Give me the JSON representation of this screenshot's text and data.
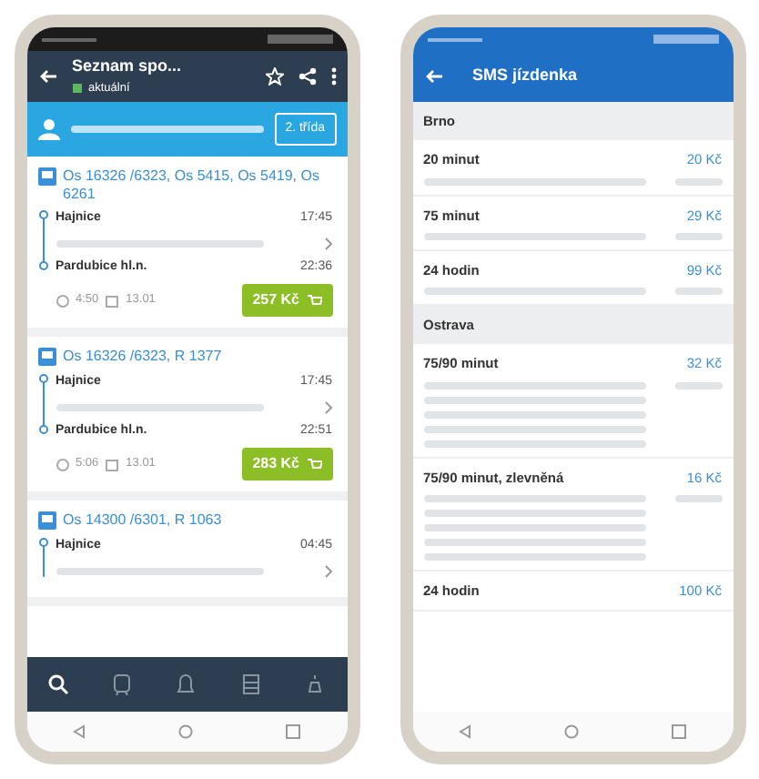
{
  "connections_screen": {
    "title": "Seznam spo...",
    "status": "aktuální",
    "class_button": "2. třída",
    "connections": [
      {
        "trains": "Os 16326 /6323, Os 5415, Os 5419, Os 6261",
        "from": "Hajnice",
        "dep": "17:45",
        "to": "Pardubice hl.n.",
        "arr": "22:36",
        "duration": "4:50",
        "date": "13.01",
        "price": "257 Kč"
      },
      {
        "trains": "Os 16326 /6323, R 1377",
        "from": "Hajnice",
        "dep": "17:45",
        "to": "Pardubice hl.n.",
        "arr": "22:51",
        "duration": "5:06",
        "date": "13.01",
        "price": "283 Kč"
      },
      {
        "trains": "Os 14300 /6301, R 1063",
        "from": "Hajnice",
        "dep": "04:45"
      }
    ],
    "nav": [
      {
        "kind": "search",
        "selected": true
      },
      {
        "kind": "train",
        "selected": false
      },
      {
        "kind": "bell",
        "selected": false
      },
      {
        "kind": "grid",
        "selected": false
      },
      {
        "kind": "alarm",
        "selected": false
      }
    ]
  },
  "sms_screen": {
    "title": "SMS jízdenka",
    "sections": [
      {
        "city": "Brno",
        "tickets": [
          {
            "name": "20 minut",
            "price": "20 Kč",
            "kind": "short"
          },
          {
            "name": "75 minut",
            "price": "29 Kč",
            "kind": "short"
          },
          {
            "name": "24 hodin",
            "price": "99 Kč",
            "kind": "short"
          }
        ]
      },
      {
        "city": "Ostrava",
        "tickets": [
          {
            "name": "75/90 minut",
            "price": "32 Kč",
            "kind": "long"
          },
          {
            "name": "75/90 minut, zlevněná",
            "price": "16 Kč",
            "kind": "long"
          },
          {
            "name": "24 hodin",
            "price": "100 Kč",
            "kind": "none"
          }
        ]
      }
    ]
  }
}
